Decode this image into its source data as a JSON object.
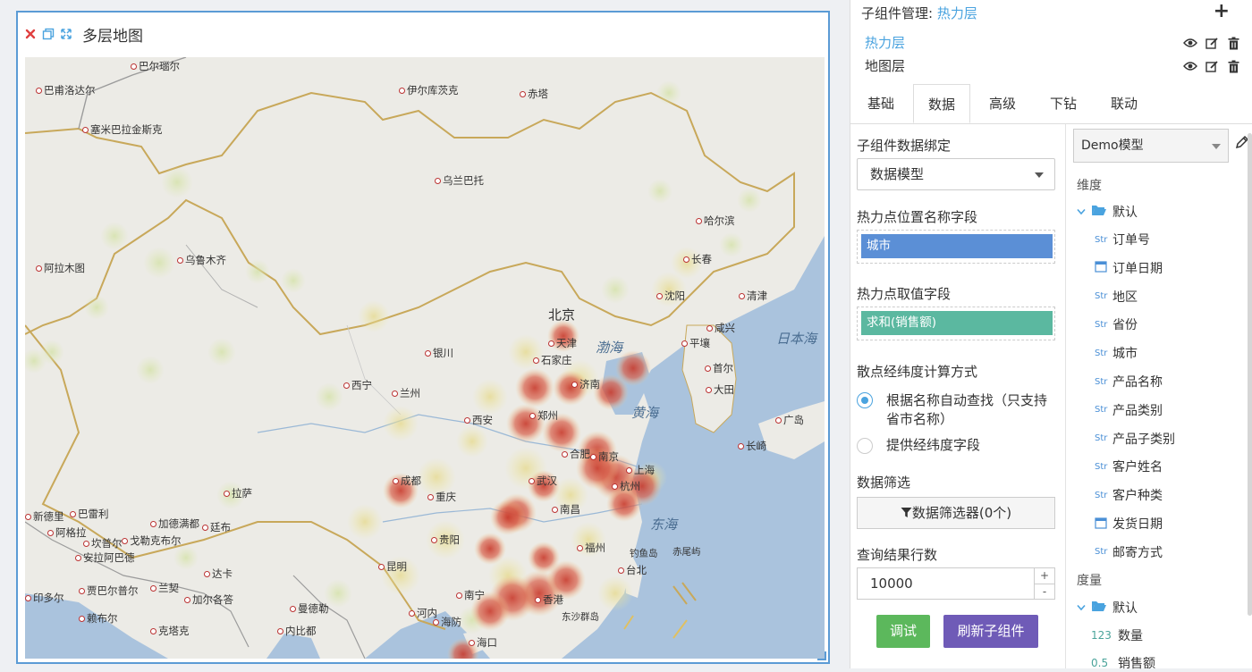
{
  "widget": {
    "title": "多层地图",
    "map": {
      "cities": [
        {
          "name": "巴尔瑙尔"
        },
        {
          "name": "巴甫洛达尔"
        },
        {
          "name": "伊尔库茨克"
        },
        {
          "name": "赤塔"
        },
        {
          "name": "塞米巴拉金斯克"
        },
        {
          "name": "乌兰巴托"
        },
        {
          "name": "哈尔滨"
        },
        {
          "name": "乌鲁木齐"
        },
        {
          "name": "长春"
        },
        {
          "name": "阿拉木图"
        },
        {
          "name": "沈阳"
        },
        {
          "name": "清津"
        },
        {
          "name": "北京",
          "big": true
        },
        {
          "name": "天津"
        },
        {
          "name": "咸兴"
        },
        {
          "name": "平壤"
        },
        {
          "name": "银川"
        },
        {
          "name": "石家庄"
        },
        {
          "name": "首尔"
        },
        {
          "name": "济南"
        },
        {
          "name": "大田"
        },
        {
          "name": "西宁"
        },
        {
          "name": "兰州"
        },
        {
          "name": "广岛"
        },
        {
          "name": "西安"
        },
        {
          "name": "郑州"
        },
        {
          "name": "长崎"
        },
        {
          "name": "合肥"
        },
        {
          "name": "南京"
        },
        {
          "name": "上海"
        },
        {
          "name": "成都"
        },
        {
          "name": "武汉"
        },
        {
          "name": "杭州"
        },
        {
          "name": "拉萨"
        },
        {
          "name": "重庆"
        },
        {
          "name": "新德里"
        },
        {
          "name": "巴雷利"
        },
        {
          "name": "加德满都"
        },
        {
          "name": "廷布"
        },
        {
          "name": "南昌"
        },
        {
          "name": "阿格拉"
        },
        {
          "name": "坎普尔"
        },
        {
          "name": "戈勒克布尔"
        },
        {
          "name": "贵阳"
        },
        {
          "name": "福州"
        },
        {
          "name": "安拉阿巴德"
        },
        {
          "name": "达卡"
        },
        {
          "name": "昆明"
        },
        {
          "name": "台北"
        },
        {
          "name": "印多尔"
        },
        {
          "name": "贾巴尔普尔"
        },
        {
          "name": "兰契"
        },
        {
          "name": "加尔各答"
        },
        {
          "name": "曼德勒"
        },
        {
          "name": "南宁"
        },
        {
          "name": "香港"
        },
        {
          "name": "赖布尔"
        },
        {
          "name": "河内"
        },
        {
          "name": "海防"
        },
        {
          "name": "克塔克"
        },
        {
          "name": "内比都"
        },
        {
          "name": "海口"
        }
      ],
      "seas": [
        "渤海",
        "黄海",
        "东海",
        "日本海"
      ],
      "islands": [
        "钓鱼岛",
        "赤尾屿",
        "东沙群岛"
      ]
    }
  },
  "panel": {
    "sub_head_label": "子组件管理:",
    "sub_head_value": "热力层",
    "layers": [
      {
        "name": "热力层",
        "active": true
      },
      {
        "name": "地图层",
        "active": false
      }
    ],
    "tabs": [
      "基础",
      "数据",
      "高级",
      "下钻",
      "联动"
    ],
    "active_tab": "数据",
    "binding_label": "子组件数据绑定",
    "binding_value": "数据模型",
    "position_field_label": "热力点位置名称字段",
    "position_field_value": "城市",
    "value_field_label": "热力点取值字段",
    "value_field_value": "求和(销售额)",
    "calc_label": "散点经纬度计算方式",
    "calc_options": [
      {
        "text": "根据名称自动查找（只支持省市名称）",
        "selected": true
      },
      {
        "text": "提供经纬度字段",
        "selected": false
      }
    ],
    "filter_label": "数据筛选",
    "filter_button": "数据筛选器(0个)",
    "rows_label": "查询结果行数",
    "rows_value": "10000",
    "debug_button": "调试",
    "refresh_button": "刷新子组件",
    "model_select": "Demo模型",
    "dimension_label": "维度",
    "dimension_folder": "默认",
    "dimensions": [
      {
        "type": "Str",
        "name": "订单号"
      },
      {
        "type": "date",
        "name": "订单日期"
      },
      {
        "type": "Str",
        "name": "地区"
      },
      {
        "type": "Str",
        "name": "省份"
      },
      {
        "type": "Str",
        "name": "城市"
      },
      {
        "type": "Str",
        "name": "产品名称"
      },
      {
        "type": "Str",
        "name": "产品类别"
      },
      {
        "type": "Str",
        "name": "产品子类别"
      },
      {
        "type": "Str",
        "name": "客户姓名"
      },
      {
        "type": "Str",
        "name": "客户种类"
      },
      {
        "type": "date",
        "name": "发货日期"
      },
      {
        "type": "Str",
        "name": "邮寄方式"
      }
    ],
    "measure_label": "度量",
    "measure_folder": "默认",
    "measures": [
      {
        "type": "123",
        "name": "数量"
      },
      {
        "type": "0.5",
        "name": "销售额"
      }
    ]
  },
  "colors": {
    "accent": "#4aa3df",
    "chip_position": "#5b8fd6",
    "chip_value": "#5bb8a0",
    "debug_btn": "#5cb85c",
    "refresh_btn": "#6f5bb7",
    "close_icon": "#e04040"
  }
}
